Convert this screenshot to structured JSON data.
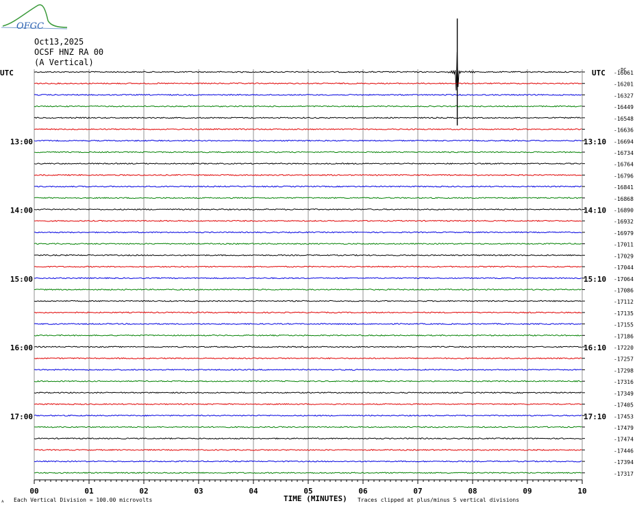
{
  "header": {
    "logo_text": "OFGC",
    "date": "Oct13,2025",
    "station": "OCSF HNZ RA 00",
    "component": "(A Vertical)"
  },
  "footer": {
    "scale_note": "Each Vertical Division =  100.00 microvolts",
    "clip_note": "Traces clipped at plus/minus 5 vertical divisions",
    "corner_mark": "ᴀ"
  },
  "chart_data": {
    "type": "line",
    "title": "",
    "xlabel": "TIME (MINUTES)",
    "ylabel": "UTC",
    "y_label_right": "UTC",
    "right_top_label": "-DC",
    "x_ticks": [
      "00",
      "01",
      "02",
      "03",
      "04",
      "05",
      "06",
      "07",
      "08",
      "09",
      "10"
    ],
    "xlim": [
      0,
      10
    ],
    "grid": true,
    "trace_colors": [
      "#000000",
      "#e00000",
      "#0000e0",
      "#008000"
    ],
    "left_hour_labels": [
      {
        "row": 6,
        "label": "13:00"
      },
      {
        "row": 12,
        "label": "14:00"
      },
      {
        "row": 18,
        "label": "15:00"
      },
      {
        "row": 24,
        "label": "16:00"
      },
      {
        "row": 30,
        "label": "17:00"
      }
    ],
    "right_time_labels": [
      {
        "row": 6,
        "label": "13:10"
      },
      {
        "row": 12,
        "label": "14:10"
      },
      {
        "row": 18,
        "label": "15:10"
      },
      {
        "row": 24,
        "label": "16:10"
      },
      {
        "row": 30,
        "label": "17:10"
      }
    ],
    "dc_offsets": [
      "-16061",
      "-16201",
      "-16327",
      "-16449",
      "-16548",
      "-16636",
      "-16694",
      "-16734",
      "-16764",
      "-16796",
      "-16841",
      "-16868",
      "-16890",
      "-16932",
      "-16979",
      "-17011",
      "-17029",
      "-17044",
      "-17064",
      "-17086",
      "-17112",
      "-17135",
      "-17155",
      "-17186",
      "-17220",
      "-17257",
      "-17298",
      "-17316",
      "-17349",
      "-17405",
      "-17453",
      "-17479",
      "-17474",
      "-17446",
      "-17394",
      "-17317"
    ],
    "events": [
      {
        "row": 0,
        "minute": 7.72,
        "description": "large clipped spike"
      }
    ]
  }
}
